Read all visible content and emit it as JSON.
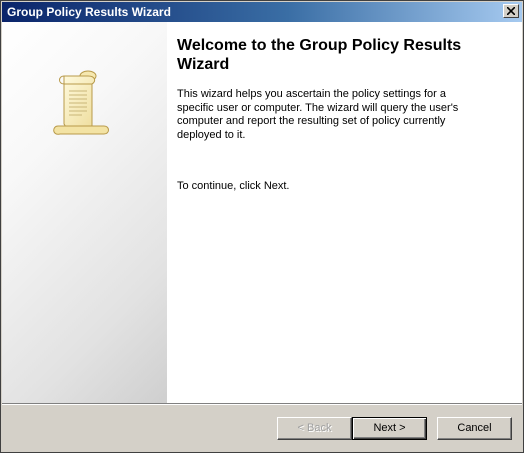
{
  "window": {
    "title": "Group Policy Results Wizard",
    "close_icon": "close-icon"
  },
  "welcome": {
    "icon": "scroll-icon",
    "heading": "Welcome to the Group Policy Results Wizard",
    "description": "This wizard helps you ascertain the policy settings for a specific user or computer. The wizard will query the user's computer and report the resulting set of policy currently deployed to it.",
    "continue_text": "To continue, click Next."
  },
  "buttons": {
    "back": "< Back",
    "next": "Next >",
    "cancel": "Cancel"
  },
  "colors": {
    "titlebar_start": "#0a246a",
    "titlebar_end": "#a6caf0",
    "face": "#d4d0c8"
  }
}
